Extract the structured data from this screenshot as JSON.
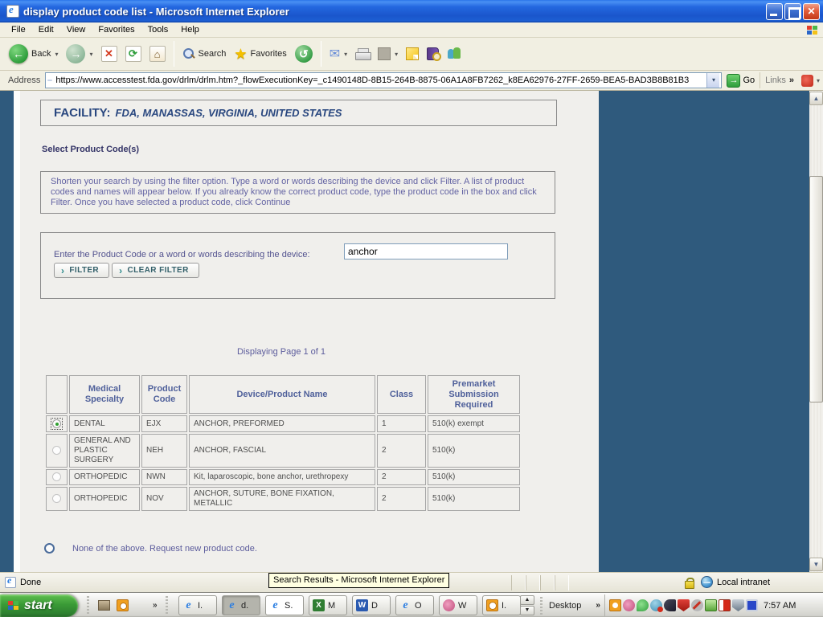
{
  "window": {
    "title": "display product code list - Microsoft Internet Explorer"
  },
  "menu": {
    "items": [
      "File",
      "Edit",
      "View",
      "Favorites",
      "Tools",
      "Help"
    ]
  },
  "toolbar": {
    "back_label": "Back",
    "search_label": "Search",
    "favorites_label": "Favorites"
  },
  "address_bar": {
    "label": "Address",
    "url": "https://www.accesstest.fda.gov/drlm/drlm.htm?_flowExecutionKey=_c1490148D-8B15-264B-8875-06A1A8FB7262_k8EA62976-27FF-2659-BEA5-BAD3B8B81B3",
    "go_label": "Go",
    "links_label": "Links"
  },
  "icons": {
    "back_arrow": "←",
    "forward_arrow": "→",
    "stop": "✕",
    "refresh": "⟳",
    "home": "⌂",
    "star": "★",
    "history": "↺",
    "mail": "✉",
    "dropdown": "▾",
    "chevron_double": "»",
    "go_arrow": "→",
    "scroll_up": "▲",
    "scroll_down": "▼",
    "close": "✕",
    "button_arrow": "›",
    "chev_up": "▲",
    "chev_down": "▼"
  },
  "page": {
    "facility_label": "FACILITY:",
    "facility_value": "FDA, MANASSAS, VIRGINIA, UNITED STATES",
    "section_title": "Select Product Code(s)",
    "instructions": "Shorten your search by using the filter option. Type a word or words describing the device and click Filter. A list of product codes and names will appear below. If you already know the correct product code, type the product code in the box and click Filter. Once you have selected a product code, click Continue",
    "filter": {
      "label": "Enter the Product Code or a word or words describing the device:",
      "value": "anchor",
      "filter_button": "FILTER",
      "clear_button": "CLEAR FILTER"
    },
    "paging": "Displaying Page 1 of 1",
    "table": {
      "headers": [
        "",
        "Medical Specialty",
        "Product Code",
        "Device/Product Name",
        "Class",
        "Premarket Submission Required"
      ],
      "rows": [
        {
          "selected": true,
          "specialty": "DENTAL",
          "code": "EJX",
          "device": "ANCHOR, PREFORMED",
          "class": "1",
          "premarket": "510(k) exempt"
        },
        {
          "selected": false,
          "specialty": "GENERAL AND PLASTIC SURGERY",
          "code": "NEH",
          "device": "ANCHOR, FASCIAL",
          "class": "2",
          "premarket": "510(k)"
        },
        {
          "selected": false,
          "specialty": "ORTHOPEDIC",
          "code": "NWN",
          "device": "Kit, laparoscopic, bone anchor, urethropexy",
          "class": "2",
          "premarket": "510(k)"
        },
        {
          "selected": false,
          "specialty": "ORTHOPEDIC",
          "code": "NOV",
          "device": "ANCHOR, SUTURE, BONE FIXATION, METALLIC",
          "class": "2",
          "premarket": "510(k)"
        }
      ]
    },
    "none_option": "None of the above. Request new product code."
  },
  "status_bar": {
    "text": "Done",
    "zone": "Local intranet"
  },
  "tooltip": "Search Results - Microsoft Internet Explorer",
  "taskbar": {
    "start_label": "start",
    "buttons": [
      {
        "label": "I.",
        "icon": "ie"
      },
      {
        "label": "d.",
        "icon": "ie",
        "active": true
      },
      {
        "label": "S.",
        "icon": "ie",
        "hover": true
      },
      {
        "label": "M",
        "icon": "excel"
      },
      {
        "label": "D",
        "icon": "word"
      },
      {
        "label": "O",
        "icon": "ie"
      },
      {
        "label": "W",
        "icon": "app"
      },
      {
        "label": "I.",
        "icon": "clock"
      }
    ],
    "desktop_label": "Desktop",
    "clock": "7:57 AM"
  },
  "colors": {
    "titlebar_blue": "#1a56cc",
    "side_panel_blue": "#2f5a7d",
    "heading_navy": "#29477f",
    "instruction_purple": "#6363a3",
    "table_header_blue": "#50619b",
    "start_green": "#3a9a36"
  }
}
